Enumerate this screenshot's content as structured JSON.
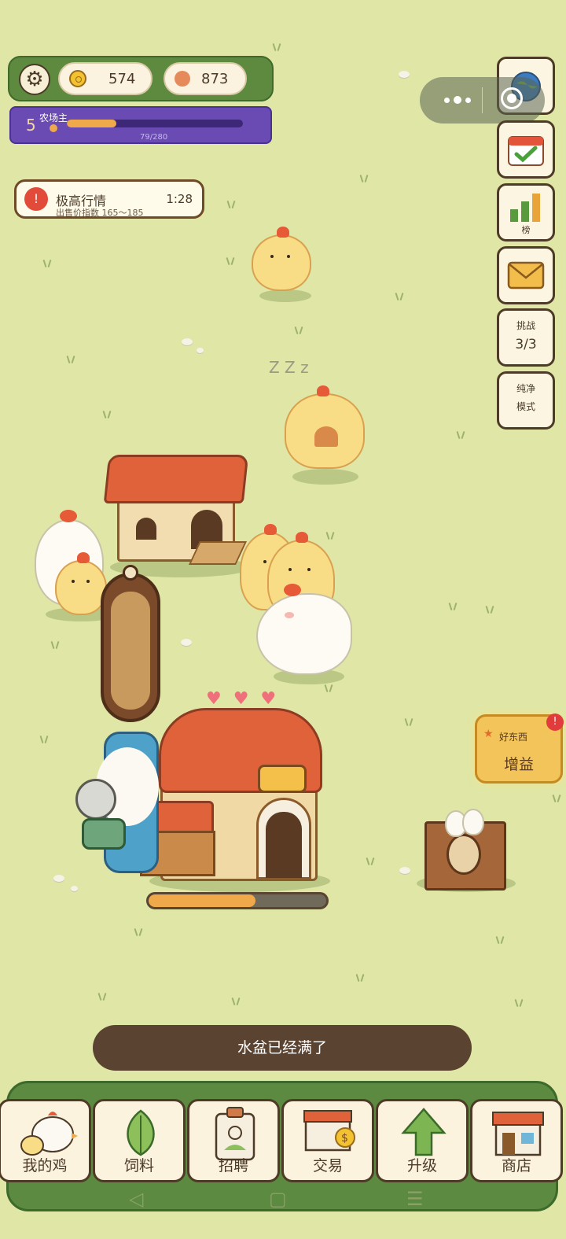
{
  "hud": {
    "settings_icon": "gear-icon",
    "coins": "574",
    "gems": "873",
    "level": "5",
    "title": "农场主",
    "exp_text": "79/280",
    "exp_fraction": 0.282
  },
  "market_alert": {
    "icon": "!",
    "title": "极高行情",
    "subtitle": "出售价指数 165～185",
    "timer": "1:28"
  },
  "side_buttons": {
    "leaderboard_label": "榜",
    "challenge_label": "挑战",
    "challenge_count": "3/3",
    "pure_label": "纯净",
    "mode_label": "模式"
  },
  "boost": {
    "small_label": "好东西",
    "big_label": "增益",
    "badge": "!"
  },
  "world": {
    "sleep_text": "Z Z z",
    "coop_progress": 0.6
  },
  "toast": "水盆已经满了",
  "nav": {
    "items": [
      {
        "label": "我的鸡",
        "icon": "chicken-icon"
      },
      {
        "label": "饲料",
        "icon": "leaf-icon"
      },
      {
        "label": "招聘",
        "icon": "badge-icon"
      },
      {
        "label": "交易",
        "icon": "market-stall-icon"
      },
      {
        "label": "升级",
        "icon": "up-arrow-icon"
      },
      {
        "label": "商店",
        "icon": "shop-icon"
      }
    ]
  }
}
